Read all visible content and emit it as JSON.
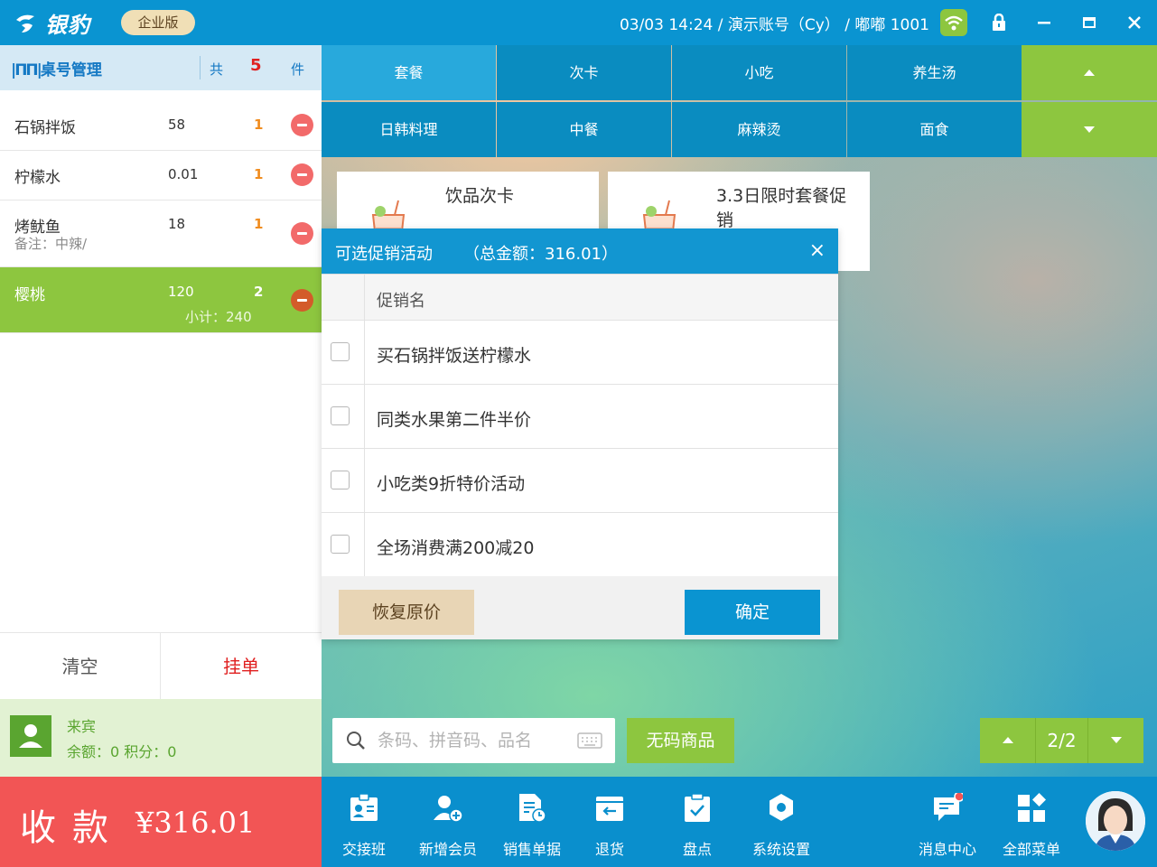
{
  "titlebar": {
    "logo": "银豹",
    "edition": "企业版",
    "status": "03/03 14:24 / 演示账号（Cy） / 嘟嘟 1001"
  },
  "table": {
    "title": "桌号管理",
    "total_prefix": "共",
    "total_count": "5",
    "total_suffix": "件"
  },
  "order_items": [
    {
      "name": "石锅拌饭",
      "price": "58",
      "qty": "1",
      "note": "",
      "subtotal": ""
    },
    {
      "name": "柠檬水",
      "price": "0.01",
      "qty": "1",
      "note": "",
      "subtotal": ""
    },
    {
      "name": "烤鱿鱼",
      "price": "18",
      "qty": "1",
      "note": "备注：中辣/",
      "subtotal": ""
    },
    {
      "name": "樱桃",
      "price": "120",
      "qty": "2",
      "note": "",
      "subtotal": "小计：240"
    }
  ],
  "actions": {
    "clear": "清空",
    "hang": "挂单"
  },
  "member": {
    "name": "来宾",
    "balance": "余额：0 积分：0"
  },
  "pay": {
    "label": "收款",
    "amount": "¥316.01"
  },
  "categories": [
    {
      "label": "套餐",
      "active": true
    },
    {
      "label": "次卡",
      "active": false
    },
    {
      "label": "小吃",
      "active": false
    },
    {
      "label": "养生汤",
      "active": false
    },
    {
      "label": "日韩料理",
      "active": false
    },
    {
      "label": "中餐",
      "active": false
    },
    {
      "label": "麻辣烫",
      "active": false
    },
    {
      "label": "面食",
      "active": false
    }
  ],
  "products": [
    {
      "title": "饮品次卡"
    },
    {
      "title": "3.3日限时套餐促销"
    }
  ],
  "dialog": {
    "title": "可选促销活动",
    "total": "（总金额：316.01）",
    "close": "×",
    "column_header": "促销名",
    "promotions": [
      {
        "name": "买石锅拌饭送柠檬水",
        "checked": false
      },
      {
        "name": "同类水果第二件半价",
        "checked": false
      },
      {
        "name": "小吃类9折特价活动",
        "checked": false
      },
      {
        "name": "全场消费满200减20",
        "checked": false
      }
    ],
    "restore_label": "恢复原价",
    "confirm_label": "确定"
  },
  "search": {
    "placeholder": "条码、拼音码、品名",
    "value": ""
  },
  "nocode_label": "无码商品",
  "pager": {
    "page": "2/2"
  },
  "toolbar": [
    {
      "label": "交接班",
      "icon": "shift-icon"
    },
    {
      "label": "新增会员",
      "icon": "add-member-icon"
    },
    {
      "label": "销售单据",
      "icon": "sales-doc-icon"
    },
    {
      "label": "退货",
      "icon": "return-icon"
    },
    {
      "label": "盘点",
      "icon": "inventory-icon"
    },
    {
      "label": "系统设置",
      "icon": "settings-icon"
    },
    {
      "label": "消息中心",
      "icon": "message-icon"
    },
    {
      "label": "全部菜单",
      "icon": "all-menu-icon"
    }
  ],
  "colors": {
    "primary": "#0a94d1",
    "green": "#8dc63f",
    "pay": "#f25555",
    "delete": "#f26a6a",
    "qty": "#f08c1e"
  }
}
